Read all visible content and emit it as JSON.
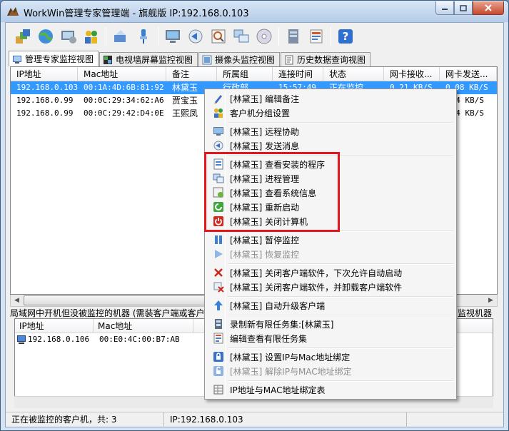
{
  "window": {
    "title": "WorkWin管理专家管理端 - 旗舰版 IP:192.168.0.103",
    "controls": {
      "minimize": "0",
      "maximize": "1",
      "close": "r"
    }
  },
  "toolbar": {
    "icons": [
      "group-icon",
      "globe-icon",
      "settings-icon",
      "users-icon",
      "network-icon",
      "paint-icon",
      "monitor-icon",
      "message-icon",
      "scan-icon",
      "windows-icon",
      "disc-icon",
      "server-icon",
      "report-icon",
      "help-icon"
    ],
    "help_label": "?"
  },
  "tabs": [
    {
      "label": "管理专家监控视图",
      "icon": "monitor-tab-icon",
      "active": true
    },
    {
      "label": "电视墙屏幕监控视图",
      "icon": "tvwall-icon",
      "active": false
    },
    {
      "label": "摄像头监控视图",
      "icon": "camera-icon",
      "active": false
    },
    {
      "label": "历史数据查询视图",
      "icon": "history-icon",
      "active": false
    }
  ],
  "monitor_table": {
    "columns": [
      "IP地址",
      "Mac地址",
      "备注",
      "所属组",
      "连接时间",
      "状态",
      "网卡接收...",
      "网卡发送..."
    ],
    "rows": [
      {
        "ip": "192.168.0.103",
        "mac": "00:1A:4D:6B:81:92",
        "note": "林黛玉",
        "group": "行政部",
        "time": "15:57:49",
        "status": "正在监控",
        "rx": "0.21 KB/S",
        "tx": "0.08 KB/S",
        "selected": true
      },
      {
        "ip": "192.168.0.99",
        "mac": "00:0C:29:34:62:A6",
        "note": "贾宝玉",
        "group": "",
        "time": "",
        "status": "",
        "rx": "",
        "tx": "4 KB/S",
        "selected": false
      },
      {
        "ip": "192.168.0.99",
        "mac": "00:0C:29:42:D4:0E",
        "note": "王熙凤",
        "group": "",
        "time": "",
        "status": "",
        "rx": "",
        "tx": "4 KB/S",
        "selected": false
      }
    ]
  },
  "scroll_arrows": {
    "left": "◀",
    "right": "▶"
  },
  "lan_section": {
    "label": "局域网中开机但没被监控的机器 (需装客户端或客户",
    "right_label": "监视机器",
    "columns": [
      "IP地址",
      "Mac地址"
    ],
    "rows": [
      {
        "ip": "192.168.0.106",
        "mac": "00:E0:4C:00:B7:AB"
      }
    ]
  },
  "status": {
    "count": "正在被监控的客户机，共: 3",
    "ip": "IP:192.168.0.103"
  },
  "context_menu": {
    "items": [
      {
        "label": "[林黛玉] 编辑备注",
        "icon": "pencil-icon",
        "disabled": false
      },
      {
        "label": "客户机分组设置",
        "icon": "group-settings-icon",
        "disabled": false
      },
      {
        "sep": true
      },
      {
        "label": "[林黛玉] 远程协助",
        "icon": "remote-icon",
        "disabled": false
      },
      {
        "label": "[林黛玉] 发送消息",
        "icon": "send-message-icon",
        "disabled": false
      },
      {
        "sep": true
      },
      {
        "label": "[林黛玉] 查看安装的程序",
        "icon": "programs-icon",
        "disabled": false
      },
      {
        "label": "[林黛玉] 进程管理",
        "icon": "process-icon",
        "disabled": false
      },
      {
        "label": "[林黛玉] 查看系统信息",
        "icon": "sysinfo-icon",
        "disabled": false
      },
      {
        "label": "[林黛玉] 重新启动",
        "icon": "restart-icon",
        "disabled": false
      },
      {
        "label": "[林黛玉] 关闭计算机",
        "icon": "power-icon",
        "disabled": false
      },
      {
        "sep": true
      },
      {
        "label": "[林黛玉] 暂停监控",
        "icon": "pause-icon",
        "disabled": false
      },
      {
        "label": "[林黛玉] 恢复监控",
        "icon": "play-icon",
        "disabled": true
      },
      {
        "sep": true
      },
      {
        "label": "[林黛玉] 关闭客户端软件，下次允许自动启动",
        "icon": "close-x-icon",
        "disabled": false
      },
      {
        "label": "[林黛玉] 关闭客户端软件，并卸载客户端软件",
        "icon": "uninstall-icon",
        "disabled": false
      },
      {
        "sep": true
      },
      {
        "label": "[林黛玉] 自动升级客户端",
        "icon": "upgrade-icon",
        "disabled": false
      },
      {
        "sep": true
      },
      {
        "label": "录制新有限任务集:[林黛玉]",
        "icon": "record-icon",
        "disabled": false
      },
      {
        "label": "编辑查看有限任务集",
        "icon": "edit-tasks-icon",
        "disabled": false
      },
      {
        "sep": true
      },
      {
        "label": "[林黛玉] 设置IP与Mac地址绑定",
        "icon": "lock-icon",
        "disabled": false
      },
      {
        "label": "[林黛玉] 解除IP与MAC地址绑定",
        "icon": "unlock-icon",
        "disabled": true
      },
      {
        "sep": true
      },
      {
        "label": "IP地址与MAC地址绑定表",
        "icon": "binding-table-icon",
        "disabled": false
      }
    ]
  },
  "colors": {
    "selection": "#3399ff",
    "highlight_box": "#e3161d"
  }
}
